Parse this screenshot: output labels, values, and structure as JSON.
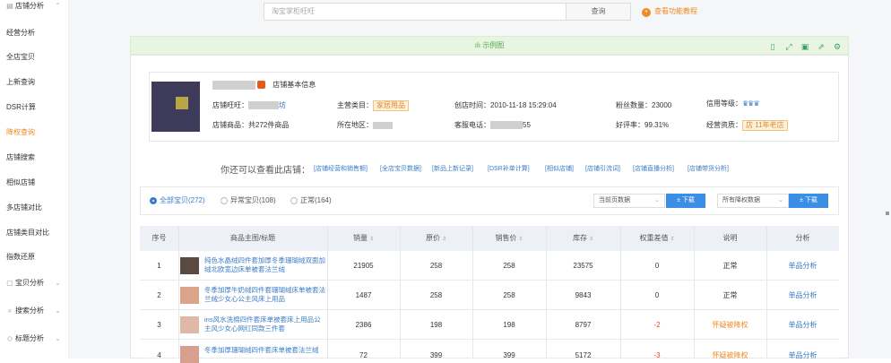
{
  "sidebar": {
    "items": [
      {
        "label": "店铺分析",
        "icon": "shop-icon",
        "chevron": "⌃",
        "top": 0
      },
      {
        "label": "经营分析"
      },
      {
        "label": "全店宝贝"
      },
      {
        "label": "上新查询"
      },
      {
        "label": "DSR计算"
      },
      {
        "label": "降权查询",
        "active": true
      },
      {
        "label": "店铺搜索"
      },
      {
        "label": "相似店铺"
      },
      {
        "label": "多店铺对比"
      },
      {
        "label": "店铺类目对比"
      },
      {
        "label": "指数还原"
      },
      {
        "label": "宝贝分析",
        "icon": "box-icon",
        "chevron": "⌄"
      },
      {
        "label": "搜索分析",
        "icon": "search-icon",
        "chevron": "⌄"
      },
      {
        "label": "标题分析",
        "icon": "tag-icon",
        "chevron": "⌄"
      }
    ]
  },
  "search": {
    "placeholder": "淘宝掌柜旺旺",
    "button": "查询",
    "tutorial": "查看功能教程",
    "tutorial_icon": "plus-circle-icon"
  },
  "example": {
    "label": "示例图",
    "icon": "bar-chart-icon"
  },
  "toolbar": {
    "icons": [
      "bookmark-icon",
      "expand-icon",
      "save-icon",
      "share-icon",
      "settings-icon"
    ],
    "glyphs": [
      "▯",
      "⤢",
      "▣",
      "⇗",
      "⚙"
    ]
  },
  "shop": {
    "basic_title": "店铺基本信息",
    "wangwang_label": "店铺旺旺：",
    "wangwang_value": "坊",
    "goods_label": "店铺商品：",
    "goods_value": "共272件商品",
    "category_label": "主营类目：",
    "category_value": "家居用品",
    "region_label": "所在地区：",
    "created_label": "创店时间：",
    "created_value": "2010-11-18 15:29:04",
    "service_label": "客服电话：",
    "service_value": "55",
    "fans_label": "粉丝数量：",
    "fans_value": "23000",
    "rating_label": "好评率：",
    "rating_value": "99.31%",
    "credit_label": "信用等级：",
    "qualify_label": "经营资质：",
    "qualify_value": "11年老店",
    "qualify_badge": "店"
  },
  "also": {
    "title": "你还可以查看此店铺：",
    "links": [
      "[店铺经营和销售额]",
      "[全店宝贝数据]",
      "[新品上新记录]",
      "[DSR补单计算]",
      "[相似店铺]",
      "[店铺引流词]",
      "[店铺直播分析]",
      "[店铺带货分析]"
    ]
  },
  "filters": {
    "radios": [
      "全部宝贝(272)",
      "异常宝贝(108)",
      "正常(164)"
    ],
    "select1": "当前页数据",
    "select2": "所有降权数据",
    "download": "± 下载"
  },
  "table": {
    "headers": [
      "序号",
      "商品主图/标题",
      "销量",
      "原价",
      "销售价",
      "库存",
      "权重差值",
      "说明",
      "分析"
    ],
    "rows": [
      {
        "no": "1",
        "title": "纯色水晶绒四件套加厚冬季珊瑚绒双面加绒北欧宽边床单被套法兰绒",
        "sales": "21905",
        "orig": "258",
        "price": "258",
        "stock": "23575",
        "weight": "0",
        "note": "正常",
        "action": "单品分析"
      },
      {
        "no": "2",
        "title": "冬季加厚牛奶绒四件套珊瑚绒床单被套法兰绒少女心公主风床上用品",
        "sales": "1487",
        "orig": "258",
        "price": "258",
        "stock": "9843",
        "weight": "0",
        "note": "正常",
        "action": "单品分析"
      },
      {
        "no": "3",
        "title": "ins风水洗棉四件套床单被套床上用品公主风少女心网红同款三件套",
        "sales": "2386",
        "orig": "198",
        "price": "198",
        "stock": "8797",
        "weight": "-2",
        "note": "怀疑被降权",
        "action": "单品分析"
      },
      {
        "no": "4",
        "title": "冬季加厚珊瑚绒四件套床单被套法兰绒",
        "sales": "72",
        "orig": "399",
        "price": "399",
        "stock": "5172",
        "weight": "-3",
        "note": "怀疑被降权",
        "action": "单品分析"
      }
    ]
  },
  "colors": {
    "accent": "#3a7cc9",
    "orange": "#f08a24",
    "negative": "#e24c2c",
    "green": "#52a84a"
  }
}
